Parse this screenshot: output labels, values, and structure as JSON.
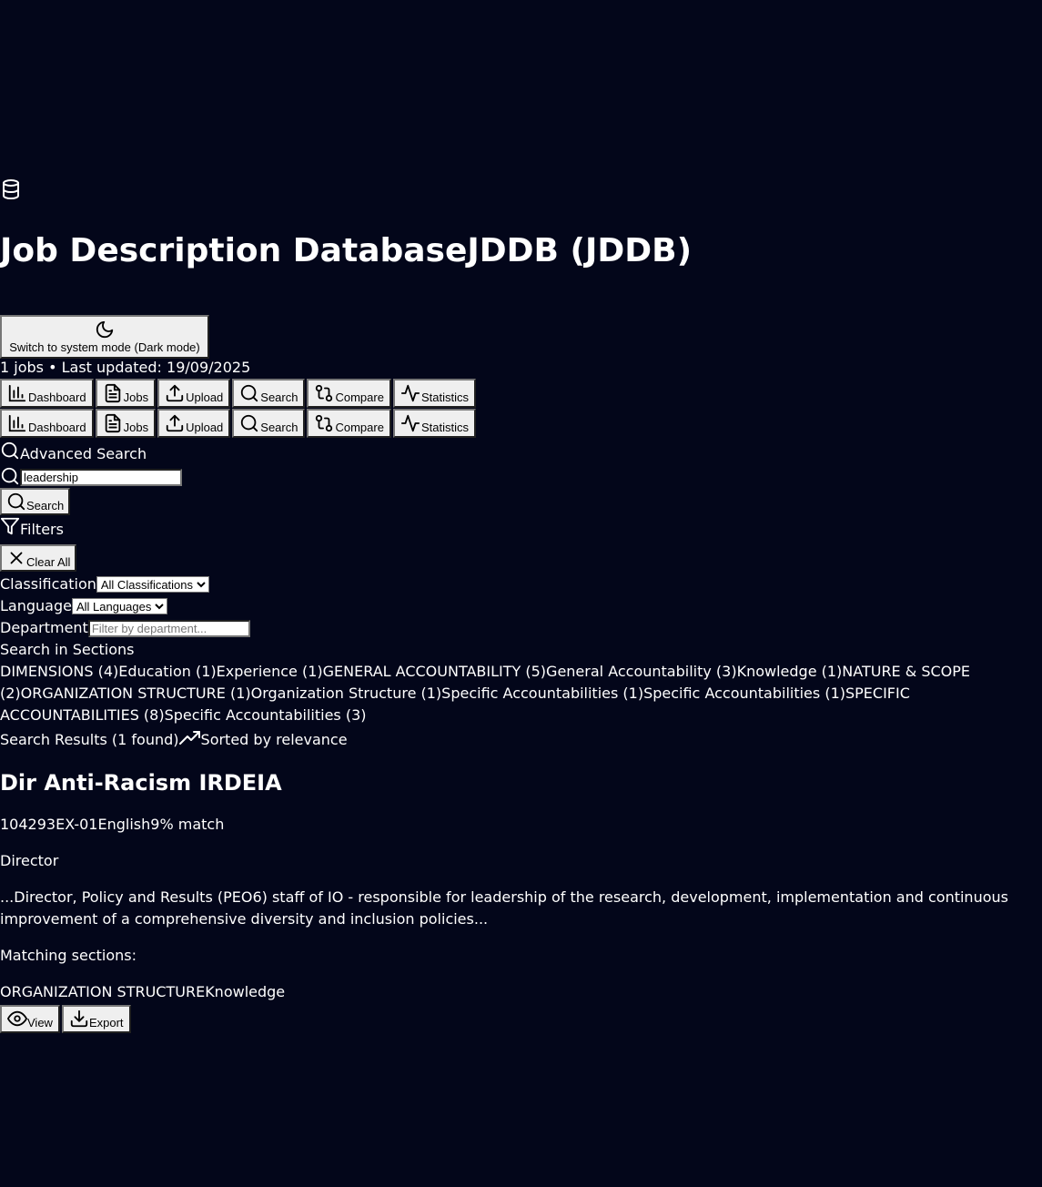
{
  "header": {
    "db_icon": "database-icon",
    "title": "Job Description DatabaseJDDB (JDDB)",
    "theme_button_label": "Switch to system mode (Dark mode)",
    "theme_icon": "moon-icon",
    "meta": "1 jobs • Last updated: 19/09/2025"
  },
  "nav": {
    "items": [
      {
        "label": "Dashboard",
        "icon": "bar-chart-icon"
      },
      {
        "label": "Jobs",
        "icon": "file-text-icon"
      },
      {
        "label": "Upload",
        "icon": "upload-icon"
      },
      {
        "label": "Search",
        "icon": "search-icon"
      },
      {
        "label": "Compare",
        "icon": "git-compare-icon"
      },
      {
        "label": "Statistics",
        "icon": "activity-icon"
      }
    ]
  },
  "search": {
    "title": "Advanced Search",
    "query": "leadership",
    "button_label": "Search"
  },
  "filters": {
    "title": "Filters",
    "clear_label": "Clear All",
    "classification_label": "Classification",
    "classification_value": "All Classifications",
    "language_label": "Language",
    "language_value": "All Languages",
    "department_label": "Department",
    "department_placeholder": "Filter by department...",
    "sections_label": "Search in Sections",
    "sections": [
      "DIMENSIONS (4)",
      "Education (1)",
      "Experience (1)",
      "GENERAL ACCOUNTABILITY (5)",
      "General Accountability (3)",
      "Knowledge (1)",
      "NATURE & SCOPE (2)",
      "ORGANIZATION STRUCTURE (1)",
      "Organization Structure (1)",
      "Specific Accountabilities (1)",
      "Specific Accountabilities (1)",
      "SPECIFIC ACCOUNTABILITIES (8)",
      "Specific Accountabilities (3)"
    ]
  },
  "results": {
    "heading": "Search Results (1 found)",
    "sort_label": "Sorted by relevance",
    "items": [
      {
        "title": "Dir Anti-Racism IRDEIA",
        "job_number": "104293",
        "classification": "EX-01",
        "language": "English",
        "match": "9% match",
        "level": "Director",
        "excerpt": "...Director, Policy and Results (PEO6) staff of IO - responsible for leadership of the research, development, implementation and continuous improvement of a comprehensive diversity and inclusion policies...",
        "matching_label": "Matching sections:",
        "matching_sections": [
          "ORGANIZATION STRUCTURE",
          "Knowledge"
        ],
        "view_label": "View",
        "export_label": "Export"
      }
    ]
  }
}
